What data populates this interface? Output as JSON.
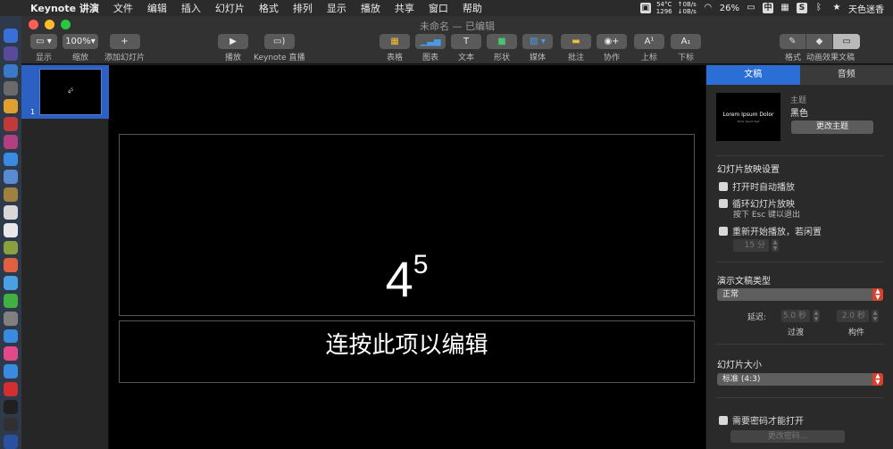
{
  "menubar": {
    "app_name": "Keynote 讲演",
    "items": [
      "文件",
      "编辑",
      "插入",
      "幻灯片",
      "格式",
      "排列",
      "显示",
      "播放",
      "共享",
      "窗口",
      "帮助"
    ],
    "cpu_temp": "54°C",
    "fan_speed": "1296",
    "net_up": "0B/s",
    "net_down": "0B/s",
    "battery": "26%",
    "input_method": "中",
    "user_name": "天色迷香"
  },
  "window": {
    "title": "未命名 — 已编辑"
  },
  "toolbar": {
    "view_label": "显示",
    "zoom_value": "100%",
    "zoom_label": "缩放",
    "add_slide_label": "添加幻灯片",
    "play_label": "播放",
    "keynote_live_label": "Keynote 直播",
    "table_label": "表格",
    "chart_label": "图表",
    "text_label": "文本",
    "shape_label": "形状",
    "media_label": "媒体",
    "comment_label": "批注",
    "collaborate_label": "协作",
    "superscript_label": "上标",
    "subscript_label": "下标",
    "format_label": "格式",
    "animate_label": "动画效果",
    "document_label": "文稿"
  },
  "navigator": {
    "slide_number": "1"
  },
  "slide": {
    "title_base": "4",
    "title_sup": "5",
    "subtitle": "连按此项以编辑"
  },
  "inspector": {
    "tab_document": "文稿",
    "tab_audio": "音频",
    "theme_thumb_title": "Lorem Ipsum Dolor",
    "theme_thumb_sub": "Dolor Ipsum Sed",
    "theme_label": "主题",
    "theme_name": "黑色",
    "change_theme": "更改主题",
    "slideshow_settings": "幻灯片放映设置",
    "autoplay": "打开时自动播放",
    "loop": "循环幻灯片放映",
    "loop_hint": "按下 Esc 键以退出",
    "restart": "重新开始播放，若闲置",
    "idle_value": "15 分",
    "presentation_type": "演示文稿类型",
    "presentation_type_value": "正常",
    "delay_label": "延迟:",
    "transition_value": "5.0 秒",
    "build_value": "2.0 秒",
    "transition_label": "过渡",
    "build_label": "构件",
    "slide_size": "幻灯片大小",
    "slide_size_value": "标准 (4:3)",
    "require_password": "需要密码才能打开",
    "change_password": "更改密码..."
  }
}
